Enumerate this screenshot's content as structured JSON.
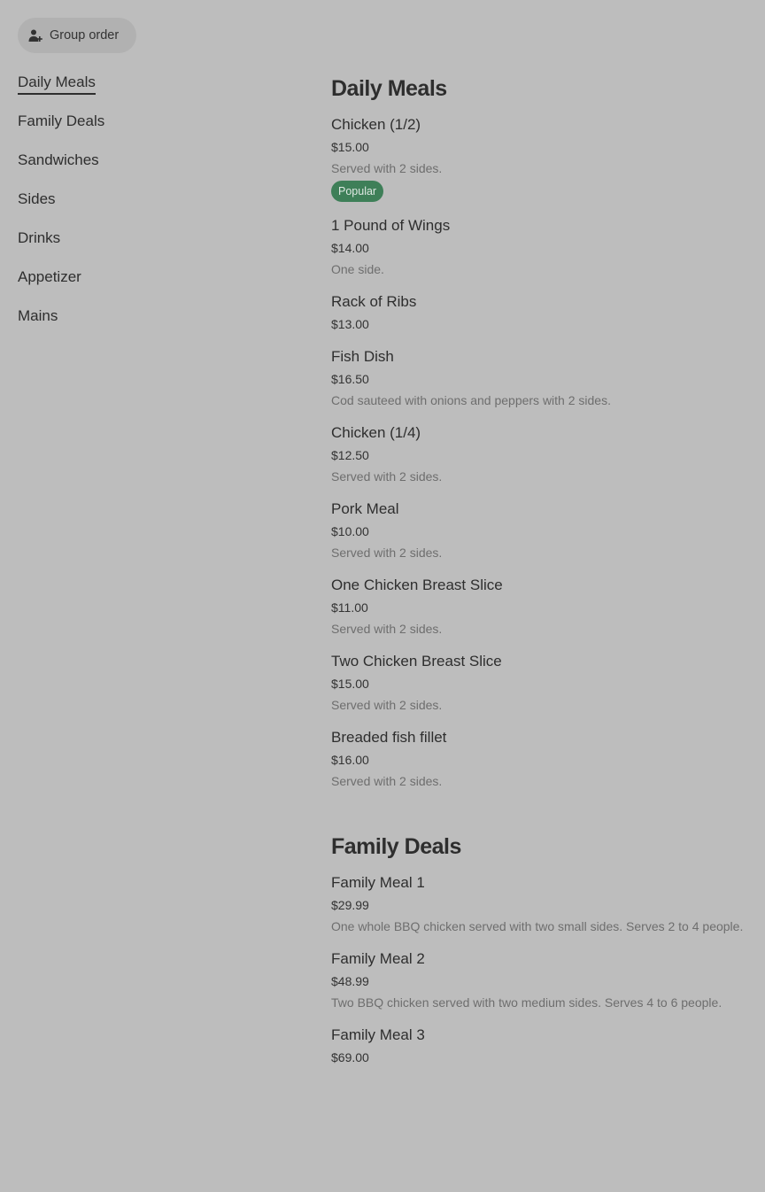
{
  "group_order": {
    "label": "Group order",
    "icon": "person-add-icon"
  },
  "nav": {
    "active": "Daily Meals",
    "items": [
      "Daily Meals",
      "Family Deals",
      "Sandwiches",
      "Sides",
      "Drinks",
      "Appetizer",
      "Mains"
    ]
  },
  "sections": [
    {
      "title": "Daily Meals",
      "items": [
        {
          "name": "Chicken (1/2)",
          "price": "$15.00",
          "description": "Served with 2 sides.",
          "badge": "Popular"
        },
        {
          "name": "1 Pound of Wings",
          "price": "$14.00",
          "description": "One side."
        },
        {
          "name": "Rack of Ribs",
          "price": "$13.00"
        },
        {
          "name": "Fish Dish",
          "price": "$16.50",
          "description": "Cod sauteed with onions and peppers with 2 sides."
        },
        {
          "name": "Chicken (1/4)",
          "price": "$12.50",
          "description": "Served with 2 sides."
        },
        {
          "name": "Pork Meal",
          "price": "$10.00",
          "description": "Served with 2 sides."
        },
        {
          "name": "One Chicken Breast Slice",
          "price": "$11.00",
          "description": "Served with 2 sides."
        },
        {
          "name": "Two Chicken Breast Slice",
          "price": "$15.00",
          "description": "Served with 2 sides."
        },
        {
          "name": "Breaded fish fillet",
          "price": "$16.00",
          "description": "Served with 2 sides."
        }
      ]
    },
    {
      "title": "Family Deals",
      "items": [
        {
          "name": "Family Meal 1",
          "price": "$29.99",
          "description": "One whole BBQ chicken served with two small sides. Serves 2 to 4 people."
        },
        {
          "name": "Family Meal 2",
          "price": "$48.99",
          "description": "Two BBQ chicken served with two medium sides. Serves 4 to 6 people."
        },
        {
          "name": "Family Meal 3",
          "price": "$69.00"
        }
      ]
    }
  ],
  "colors": {
    "background": "#bdbdbd",
    "badge": "#3e7f58",
    "text": "#2e2e2e",
    "muted": "#6e6e6e"
  }
}
